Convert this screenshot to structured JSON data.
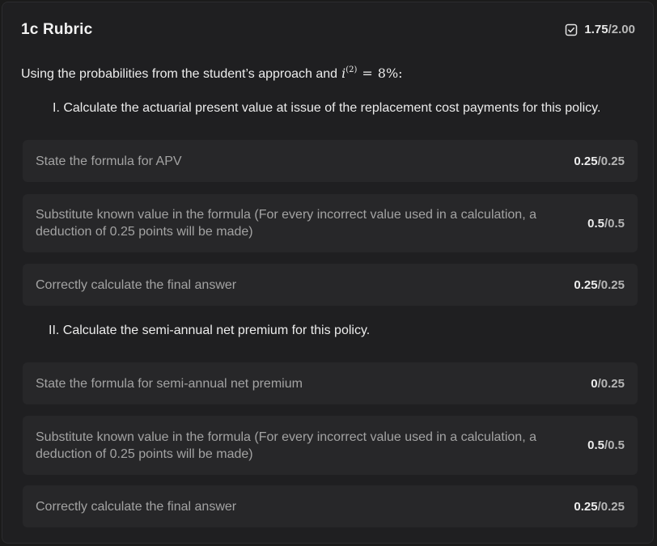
{
  "rubric": {
    "title": "1c Rubric",
    "score_earned": "1.75",
    "score_total": "/2.00",
    "intro_text": "Using the probabilities from the student’s approach and",
    "intro_math": {
      "var": "i",
      "sup": "(2)",
      "eq": "=",
      "value": "8%:"
    }
  },
  "sections": [
    {
      "question": "I. Calculate the actuarial present value at issue of the replacement cost payments for this policy.",
      "criteria": [
        {
          "label": "State the formula for APV",
          "earned": "0.25",
          "total": "/0.25"
        },
        {
          "label": "Substitute known value in the formula (For every incorrect value used in a calculation, a deduction of 0.25 points will be made)",
          "earned": "0.5",
          "total": "/0.5"
        },
        {
          "label": "Correctly calculate the final answer",
          "earned": "0.25",
          "total": "/0.25"
        }
      ]
    },
    {
      "question": "II. Calculate the semi-annual net premium for this policy.",
      "criteria": [
        {
          "label": "State the formula for semi-annual net premium",
          "earned": "0",
          "total": "/0.25"
        },
        {
          "label": "Substitute known value in the formula (For every incorrect value used in a calculation, a deduction of 0.25 points will be made)",
          "earned": "0.5",
          "total": "/0.5"
        },
        {
          "label": "Correctly calculate the final answer",
          "earned": "0.25",
          "total": "/0.25"
        }
      ]
    }
  ],
  "icons": {
    "score_badge": "check-square-icon"
  },
  "colors": {
    "background": "#1f1f21",
    "row_background": "#272729",
    "text_primary": "#ececec",
    "text_muted": "#a3a3a3"
  }
}
